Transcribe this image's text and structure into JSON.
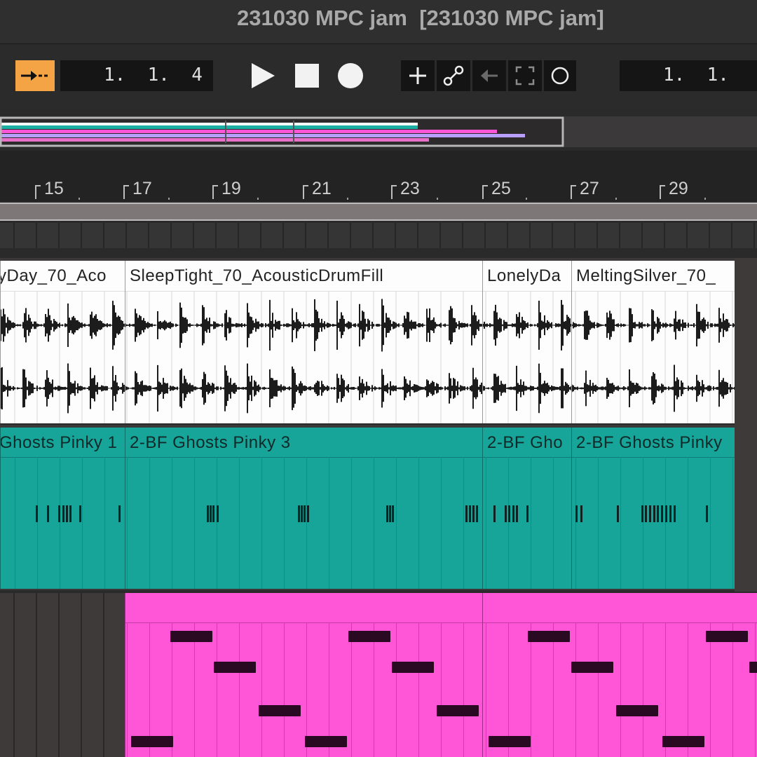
{
  "window": {
    "title": "231030 MPC jam  [231030 MPC jam]"
  },
  "transport": {
    "follow_icon": "follow-arrow-icon",
    "position": "1.  1.  4",
    "loop_start": "1.  1.",
    "accent_color": "#f5a445"
  },
  "ruler": {
    "bars": [
      "15",
      "17",
      "19",
      "21",
      "23",
      "25",
      "27",
      "29"
    ]
  },
  "tracks": {
    "audio": {
      "color": "#ffffff",
      "clips": [
        {
          "name": "yDay_70_Aco"
        },
        {
          "name": "SleepTight_70_AcousticDrumFill"
        },
        {
          "name": "LonelyDa"
        },
        {
          "name": "MeltingSilver_70_"
        }
      ]
    },
    "midi_teal": {
      "color": "#17a59a",
      "clips": [
        {
          "name": "Ghosts Pinky 1"
        },
        {
          "name": "2-BF Ghosts Pinky 3"
        },
        {
          "name": "2-BF Gho"
        },
        {
          "name": "2-BF Ghosts Pinky"
        }
      ]
    },
    "midi_pink": {
      "color": "#ff55d7",
      "clips": [
        {
          "name": ""
        },
        {
          "name": ""
        }
      ]
    }
  }
}
